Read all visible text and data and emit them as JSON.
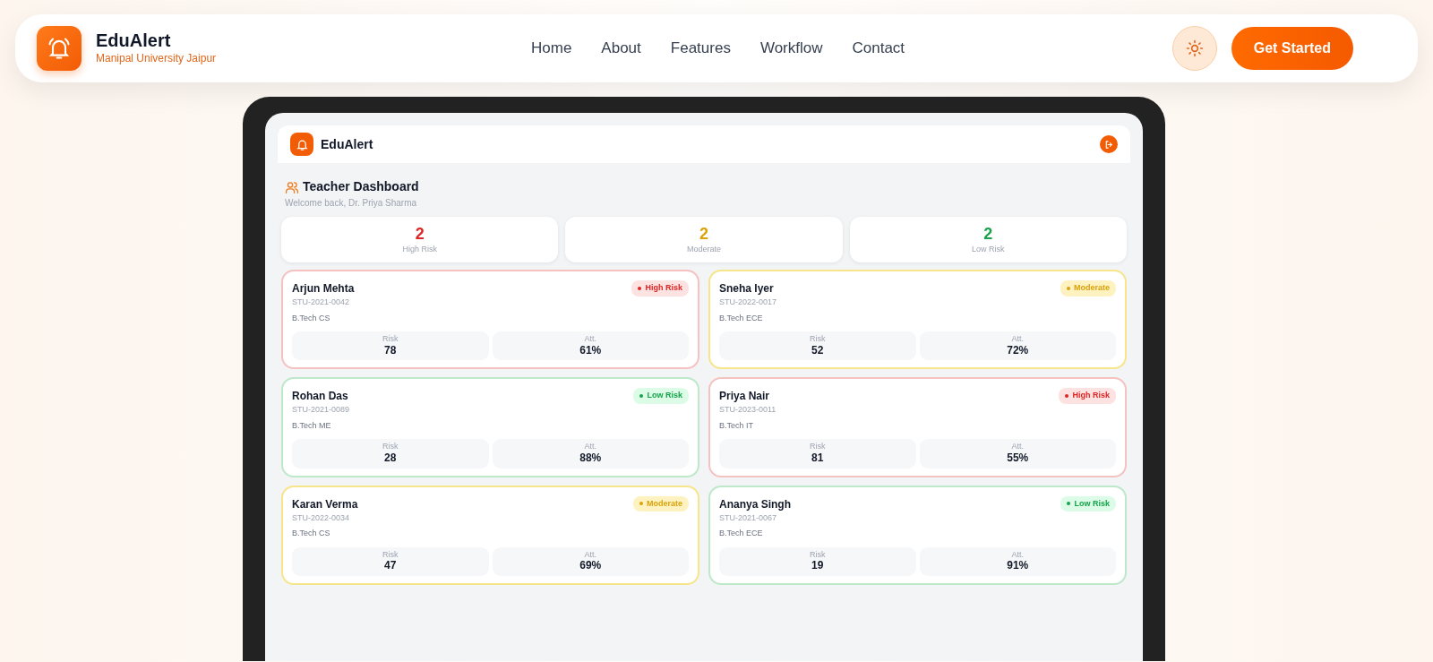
{
  "navbar": {
    "brand": "EduAlert",
    "subtitle": "Manipal University Jaipur",
    "links": [
      "Home",
      "About",
      "Features",
      "Workflow",
      "Contact"
    ],
    "cta": "Get Started"
  },
  "app": {
    "brand": "EduAlert",
    "title": "Teacher Dashboard",
    "welcome": "Welcome back, Dr. Priya Sharma",
    "stats": [
      {
        "value": "2",
        "label": "High Risk",
        "kind": "high"
      },
      {
        "value": "2",
        "label": "Moderate",
        "kind": "moderate"
      },
      {
        "value": "2",
        "label": "Low Risk",
        "kind": "low"
      }
    ],
    "students": [
      {
        "name": "Arjun Mehta",
        "id": "STU-2021-0042",
        "program": "B.Tech CS",
        "kind": "high",
        "badge": "High Risk",
        "risk_label": "Risk",
        "risk": "78",
        "att_label": "Att.",
        "att": "61%"
      },
      {
        "name": "Sneha Iyer",
        "id": "STU-2022-0017",
        "program": "B.Tech ECE",
        "kind": "moderate",
        "badge": "Moderate",
        "risk_label": "Risk",
        "risk": "52",
        "att_label": "Att.",
        "att": "72%"
      },
      {
        "name": "Rohan Das",
        "id": "STU-2021-0089",
        "program": "B.Tech ME",
        "kind": "low",
        "badge": "Low Risk",
        "risk_label": "Risk",
        "risk": "28",
        "att_label": "Att.",
        "att": "88%"
      },
      {
        "name": "Priya Nair",
        "id": "STU-2023-0011",
        "program": "B.Tech IT",
        "kind": "high",
        "badge": "High Risk",
        "risk_label": "Risk",
        "risk": "81",
        "att_label": "Att.",
        "att": "55%"
      },
      {
        "name": "Karan Verma",
        "id": "STU-2022-0034",
        "program": "B.Tech CS",
        "kind": "moderate",
        "badge": "Moderate",
        "risk_label": "Risk",
        "risk": "47",
        "att_label": "Att.",
        "att": "69%"
      },
      {
        "name": "Ananya Singh",
        "id": "STU-2021-0067",
        "program": "B.Tech ECE",
        "kind": "low",
        "badge": "Low Risk",
        "risk_label": "Risk",
        "risk": "19",
        "att_label": "Att.",
        "att": "91%"
      }
    ]
  }
}
